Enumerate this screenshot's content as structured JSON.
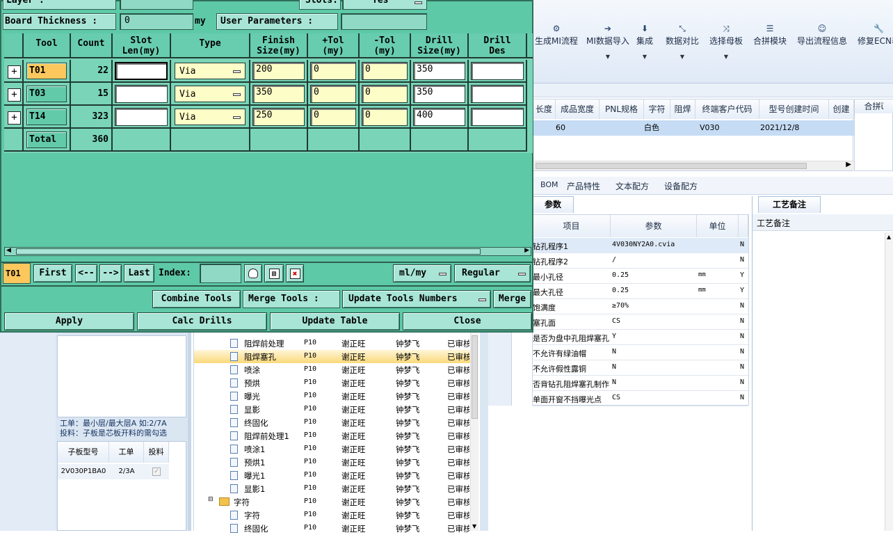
{
  "dialog": {
    "layer_label": "Layer :",
    "slots_label": "Slots:",
    "slots_value": "Yes",
    "board_thickness_label": "Board Thickness :",
    "board_thickness_value": "0",
    "board_thickness_unit": "my",
    "user_params_label": "User Parameters :",
    "headers": {
      "tool": "Tool",
      "count": "Count",
      "slot_len_1": "Slot",
      "slot_len_2": "Len(my)",
      "type": "Type",
      "finish_1": "Finish",
      "finish_2": "Size(my)",
      "ptol_1": "+Tol",
      "ptol_2": "(my)",
      "ntol_1": "-Tol",
      "ntol_2": "(my)",
      "drill_1": "Drill",
      "drill_2": "Size(my)",
      "des_1": "Drill",
      "des_2": "Des"
    },
    "rows": [
      {
        "tool": "T01",
        "count": "22",
        "slot_len": "",
        "type": "Via",
        "finish": "200",
        "ptol": "0",
        "ntol": "0",
        "drill": "350",
        "des": ""
      },
      {
        "tool": "T03",
        "count": "15",
        "slot_len": "",
        "type": "Via",
        "finish": "350",
        "ptol": "0",
        "ntol": "0",
        "drill": "350",
        "des": ""
      },
      {
        "tool": "T14",
        "count": "323",
        "slot_len": "",
        "type": "Via",
        "finish": "250",
        "ptol": "0",
        "ntol": "0",
        "drill": "400",
        "des": ""
      }
    ],
    "total_label": "Total",
    "total_count": "360",
    "nav": {
      "current": "T01",
      "first": "First",
      "prev": "<--",
      "next": "-->",
      "last": "Last",
      "index_label": "Index:",
      "units": "ml/my",
      "mode": "Regular"
    },
    "combine_tools": "Combine Tools",
    "merge_tools_label": "Merge Tools :",
    "update_tools_numbers": "Update Tools Numbers",
    "merge": "Merge",
    "apply": "Apply",
    "calc_drills": "Calc Drills",
    "update_table": "Update Table",
    "close": "Close"
  },
  "toolbar": {
    "items": [
      "生成MI流程",
      "MI数据导入",
      "集成",
      "数据对比",
      "选择母板",
      "合拼模块",
      "导出流程信息",
      "修复ECN表"
    ]
  },
  "top_grid": {
    "headers": [
      "长度",
      "成品宽度",
      "PNL规格",
      "字符",
      "阻焊",
      "终端客户代码",
      "型号创建时间",
      "创建"
    ],
    "side_header": "合拼ϊ",
    "row": {
      "width": "60",
      "char": "白色",
      "customer": "V030",
      "created": "2021/12/8"
    }
  },
  "tabs": [
    "BOM",
    "产品特性",
    "文本配方",
    "设备配方"
  ],
  "param_tab": "参数",
  "param_headers": {
    "item": "项目",
    "param": "参数",
    "unit": "单位"
  },
  "params": [
    {
      "item": "钻孔程序1",
      "value": "4V030NY2A0.cvia",
      "unit": "",
      "flag": "N"
    },
    {
      "item": "钻孔程序2",
      "value": "/",
      "unit": "",
      "flag": "N"
    },
    {
      "item": "最小孔径",
      "value": "0.25",
      "unit": "mm",
      "flag": "Y"
    },
    {
      "item": "最大孔径",
      "value": "0.25",
      "unit": "mm",
      "flag": "Y"
    },
    {
      "item": "饱满度",
      "value": "≥70%",
      "unit": "",
      "flag": "N"
    },
    {
      "item": "塞孔面",
      "value": "CS",
      "unit": "",
      "flag": "N"
    },
    {
      "item": "是否为盘中孔阻焊塞孔",
      "value": "Y",
      "unit": "",
      "flag": "N"
    },
    {
      "item": "不允许有绿油帽",
      "value": "N",
      "unit": "",
      "flag": "N"
    },
    {
      "item": "不允许假性露铜",
      "value": "N",
      "unit": "",
      "flag": "N"
    },
    {
      "item": "是否背钻孔阻焊塞孔制作",
      "value": "N",
      "unit": "",
      "flag": "N"
    },
    {
      "item": "单面开窗不挡曝光点",
      "value": "CS",
      "unit": "",
      "flag": "N"
    }
  ],
  "notes": {
    "tab": "工艺备注",
    "label": "工艺备注"
  },
  "left_panel": {
    "note_line1": "工单：最小层/最大层A 如:2/7A",
    "note_line2": "投料：子板是芯板开料的需勾选",
    "headers": [
      "子板型号",
      "工单",
      "投料"
    ],
    "row": {
      "model": "2V030P1BA0",
      "order": "2/3A"
    }
  },
  "tree": {
    "rows": [
      {
        "name": "阻焊前处理",
        "code": "P10",
        "person": "谢正旺",
        "person2": "钟梦飞",
        "status": "已审核"
      },
      {
        "name": "阻焊塞孔",
        "code": "P10",
        "person": "谢正旺",
        "person2": "钟梦飞",
        "status": "已审核"
      },
      {
        "name": "喷涂",
        "code": "P10",
        "person": "谢正旺",
        "person2": "钟梦飞",
        "status": "已审核"
      },
      {
        "name": "预烘",
        "code": "P10",
        "person": "谢正旺",
        "person2": "钟梦飞",
        "status": "已审核"
      },
      {
        "name": "曝光",
        "code": "P10",
        "person": "谢正旺",
        "person2": "钟梦飞",
        "status": "已审核"
      },
      {
        "name": "显影",
        "code": "P10",
        "person": "谢正旺",
        "person2": "钟梦飞",
        "status": "已审核"
      },
      {
        "name": "终固化",
        "code": "P10",
        "person": "谢正旺",
        "person2": "钟梦飞",
        "status": "已审核"
      },
      {
        "name": "阻焊前处理1",
        "code": "P10",
        "person": "谢正旺",
        "person2": "钟梦飞",
        "status": "已审核"
      },
      {
        "name": "喷涂1",
        "code": "P10",
        "person": "谢正旺",
        "person2": "钟梦飞",
        "status": "已审核"
      },
      {
        "name": "预烘1",
        "code": "P10",
        "person": "谢正旺",
        "person2": "钟梦飞",
        "status": "已审核"
      },
      {
        "name": "曝光1",
        "code": "P10",
        "person": "谢正旺",
        "person2": "钟梦飞",
        "status": "已审核"
      },
      {
        "name": "显影1",
        "code": "P10",
        "person": "谢正旺",
        "person2": "钟梦飞",
        "status": "已审核"
      },
      {
        "name": "字符",
        "code": "P10",
        "person": "谢正旺",
        "person2": "钟梦飞",
        "status": "已审核"
      },
      {
        "name": "字符",
        "code": "P10",
        "person": "谢正旺",
        "person2": "钟梦飞",
        "status": "已审核"
      },
      {
        "name": "终固化",
        "code": "P10",
        "person": "谢正旺",
        "person2": "钟梦飞",
        "status": "已审核"
      }
    ]
  }
}
